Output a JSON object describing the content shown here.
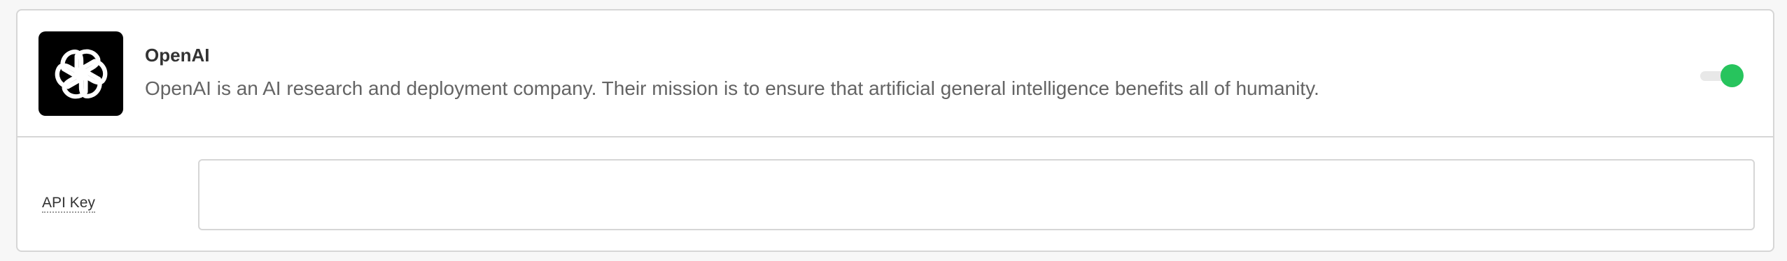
{
  "provider": {
    "name": "OpenAI",
    "description": "OpenAI is an AI research and deployment company. Their mission is to ensure that artificial general intelligence benefits all of humanity.",
    "logo_icon": "openai-logo-icon",
    "enabled": true,
    "toggle_color": "#27c45d"
  },
  "settings": {
    "api_key_label": "API Key",
    "api_key_value": ""
  }
}
